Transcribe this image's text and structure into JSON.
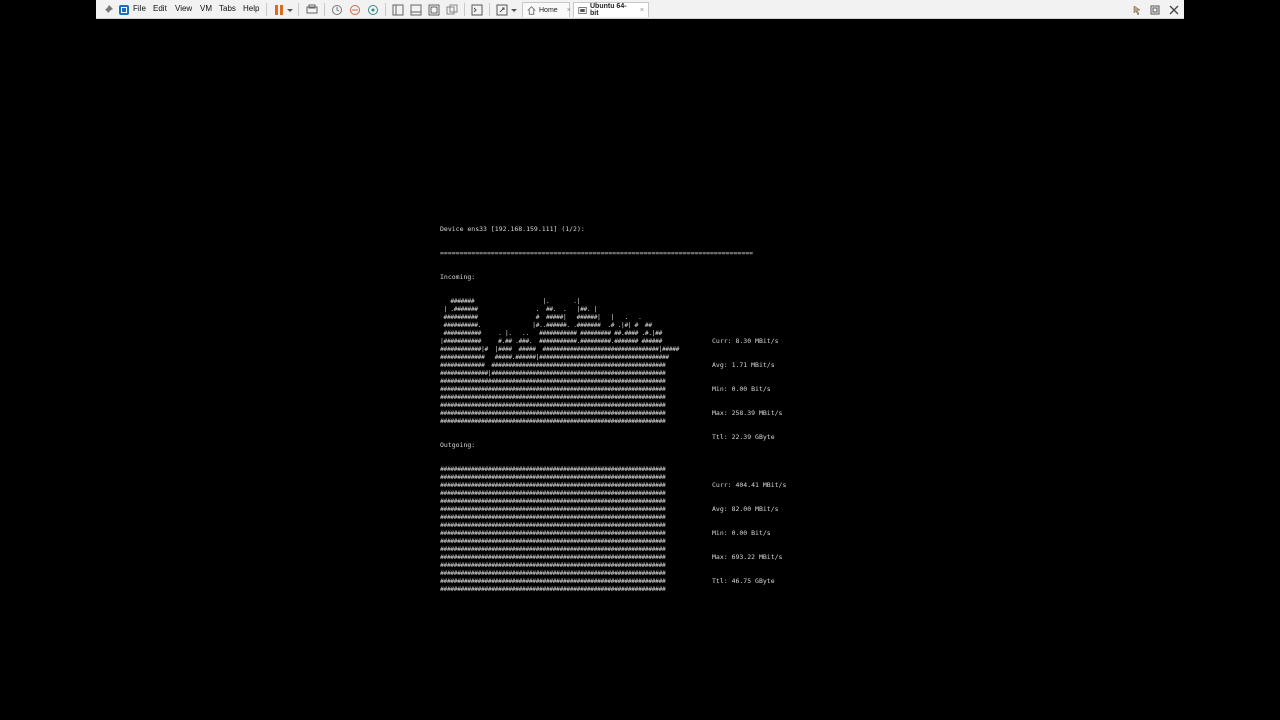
{
  "menu": {
    "file": "File",
    "edit": "Edit",
    "view": "View",
    "vm": "VM",
    "tabs": "Tabs",
    "help": "Help"
  },
  "tabs": [
    {
      "label": "Home",
      "icon": "home-icon"
    },
    {
      "label": "Ubuntu 64-bit",
      "icon": "vm-icon",
      "active": true
    }
  ],
  "terminal": {
    "header": "Device ens33 [192.168.159.111] (1/2):",
    "separator": "================================================================================",
    "incoming_label": "Incoming:",
    "incoming_graph": [
      "   #######                    |.       .|",
      " | .#######                 .  ##.  .   |##. |",
      " ##########                 #  #####|   ######|   |   .   .",
      " ##########.               |#..######. .#######  .# .|#| #  ##",
      " ###########     . |.   ..   ########### ######### ##.#### .#.|##",
      "|###########     #.## .###.  ###########.#########.####### ######",
      "############|#  |####  #####  ##################################|#####",
      "#############   #####.######|######################################",
      "#############  ###################################################",
      "##############|###################################################",
      "##################################################################",
      "##################################################################",
      "##################################################################",
      "##################################################################",
      "##################################################################",
      "##################################################################"
    ],
    "incoming_stats": {
      "curr": "Curr: 8.30 MBit/s",
      "avg": "Avg: 1.71 MBit/s",
      "min": "Min: 0.00 Bit/s",
      "max": "Max: 258.39 MBit/s",
      "ttl": "Ttl: 22.39 GByte"
    },
    "outgoing_label": "Outgoing:",
    "outgoing_graph": [
      "##################################################################",
      "##################################################################",
      "##################################################################",
      "##################################################################",
      "##################################################################",
      "##################################################################",
      "##################################################################",
      "##################################################################",
      "##################################################################",
      "##################################################################",
      "##################################################################",
      "##################################################################",
      "##################################################################",
      "##################################################################",
      "##################################################################",
      "##################################################################"
    ],
    "outgoing_stats": {
      "curr": "Curr: 404.41 MBit/s",
      "avg": "Avg: 82.00 MBit/s",
      "min": "Min: 0.00 Bit/s",
      "max": "Max: 693.22 MBit/s",
      "ttl": "Ttl: 46.75 GByte"
    }
  }
}
